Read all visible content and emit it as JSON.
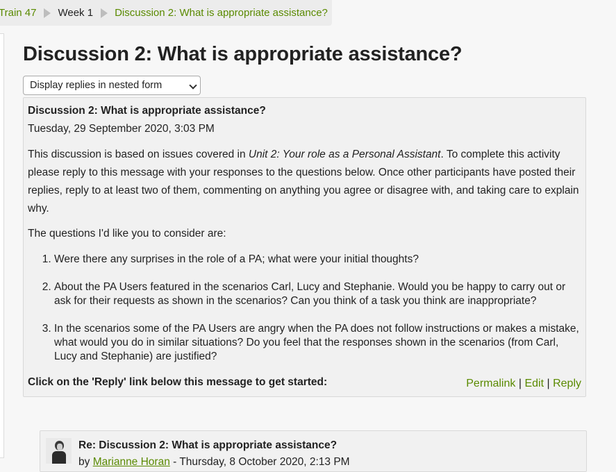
{
  "breadcrumb": {
    "items": [
      "Train 47",
      "Week 1",
      "Discussion 2: What is appropriate assistance?"
    ]
  },
  "page_title": "Discussion 2: What is appropriate assistance?",
  "display_mode": {
    "selected": "Display replies in nested form"
  },
  "post": {
    "subject": "Discussion 2: What is appropriate assistance?",
    "date": "Tuesday, 29 September 2020, 3:03 PM",
    "intro_before": "This discussion is based on issues covered in ",
    "intro_em": "Unit 2: Your role as a Personal Assistant",
    "intro_after": ". To complete this activity please reply to this message with your responses to the questions below. Once other participants have posted their replies, reply to at least two of them, commenting on anything you agree or disagree with, and taking care to explain why.",
    "questions_intro": "The questions I'd like you to consider are:",
    "questions": [
      "Were there any surprises in the role of a PA; what were your initial thoughts?",
      "About the PA Users featured in the scenarios Carl, Lucy and Stephanie. Would you be happy to carry out or ask for their requests as shown in the scenarios? Can you think of a task you think are inappropriate?",
      "In the scenarios some of the PA Users are angry when the PA does not follow instructions or makes a mistake, what would you do in similar situations? Do you feel that the responses shown in the scenarios (from Carl, Lucy and Stephanie) are justified?"
    ],
    "cta": "Click on the 'Reply' link below this message to get started:",
    "actions": {
      "permalink": "Permalink",
      "edit": "Edit",
      "reply": "Reply",
      "sep": "|"
    }
  },
  "reply": {
    "subject": "Re: Discussion 2: What is appropriate assistance?",
    "by_prefix": "by ",
    "author": "Marianne Horan",
    "date_suffix": " - Thursday, 8 October 2020, 2:13 PM"
  },
  "colors": {
    "link": "#5a8a00",
    "panel": "#f1f1f1",
    "breadcrumb_bg": "#ececec"
  }
}
